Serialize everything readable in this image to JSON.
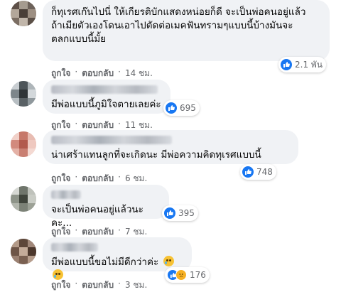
{
  "comments": [
    {
      "text_lines": [
        "ก็ทุเรศเก๊นไปนี่ ให้เกียรติบักแสดงหน่อยก็ดี จะเป็นพ่อคนอยู่แล้ว",
        "ถ้าเมียตัวเองโดนเอาไปตัดต่อเมคฟันทรามๆแบบนี้บ้างมันจะ",
        "ตลกแบบนี้มั้ย"
      ],
      "reaction_count": "2.1 พัน",
      "like_label": "ถูกใจ",
      "reply_label": "ตอบกลับ",
      "time": "14 ชม."
    },
    {
      "text_lines": [
        "มีพ่อแบบนี้ภูมิใจตายเลยค่ะ"
      ],
      "reaction_count": "695",
      "like_label": "ถูกใจ",
      "reply_label": "ตอบกลับ",
      "time": "11 ชม."
    },
    {
      "text_lines": [
        "น่าเศร้าแทนลูกที่จะเกิดนะ มีพ่อความคิดทุเรศแบบนี้"
      ],
      "reaction_count": "748",
      "like_label": "ถูกใจ",
      "reply_label": "ตอบกลับ",
      "time": "6 ชม."
    },
    {
      "text_lines": [
        "จะเป็นพ่อคนอยู่แล้วนะคะ..."
      ],
      "reaction_count": "395",
      "like_label": "ถูกใจ",
      "reply_label": "ตอบกลับ",
      "time": "7 ชม."
    },
    {
      "text_lines": [
        "มีพ่อแบบนี้ขอไม่มีดีกว่าค่ะ"
      ],
      "reaction_count": "176",
      "like_label": "ถูกใจ",
      "reply_label": "ตอบกลับ",
      "time": "3 ชม."
    }
  ],
  "colors": {
    "bubble_bg": "#f0f2f5",
    "like_blue": "#1877f2",
    "sad_yellow": "#f7b125",
    "meta_gray": "#65676b"
  },
  "icons": [
    "like-icon",
    "sad-icon",
    "crying-emoji"
  ]
}
